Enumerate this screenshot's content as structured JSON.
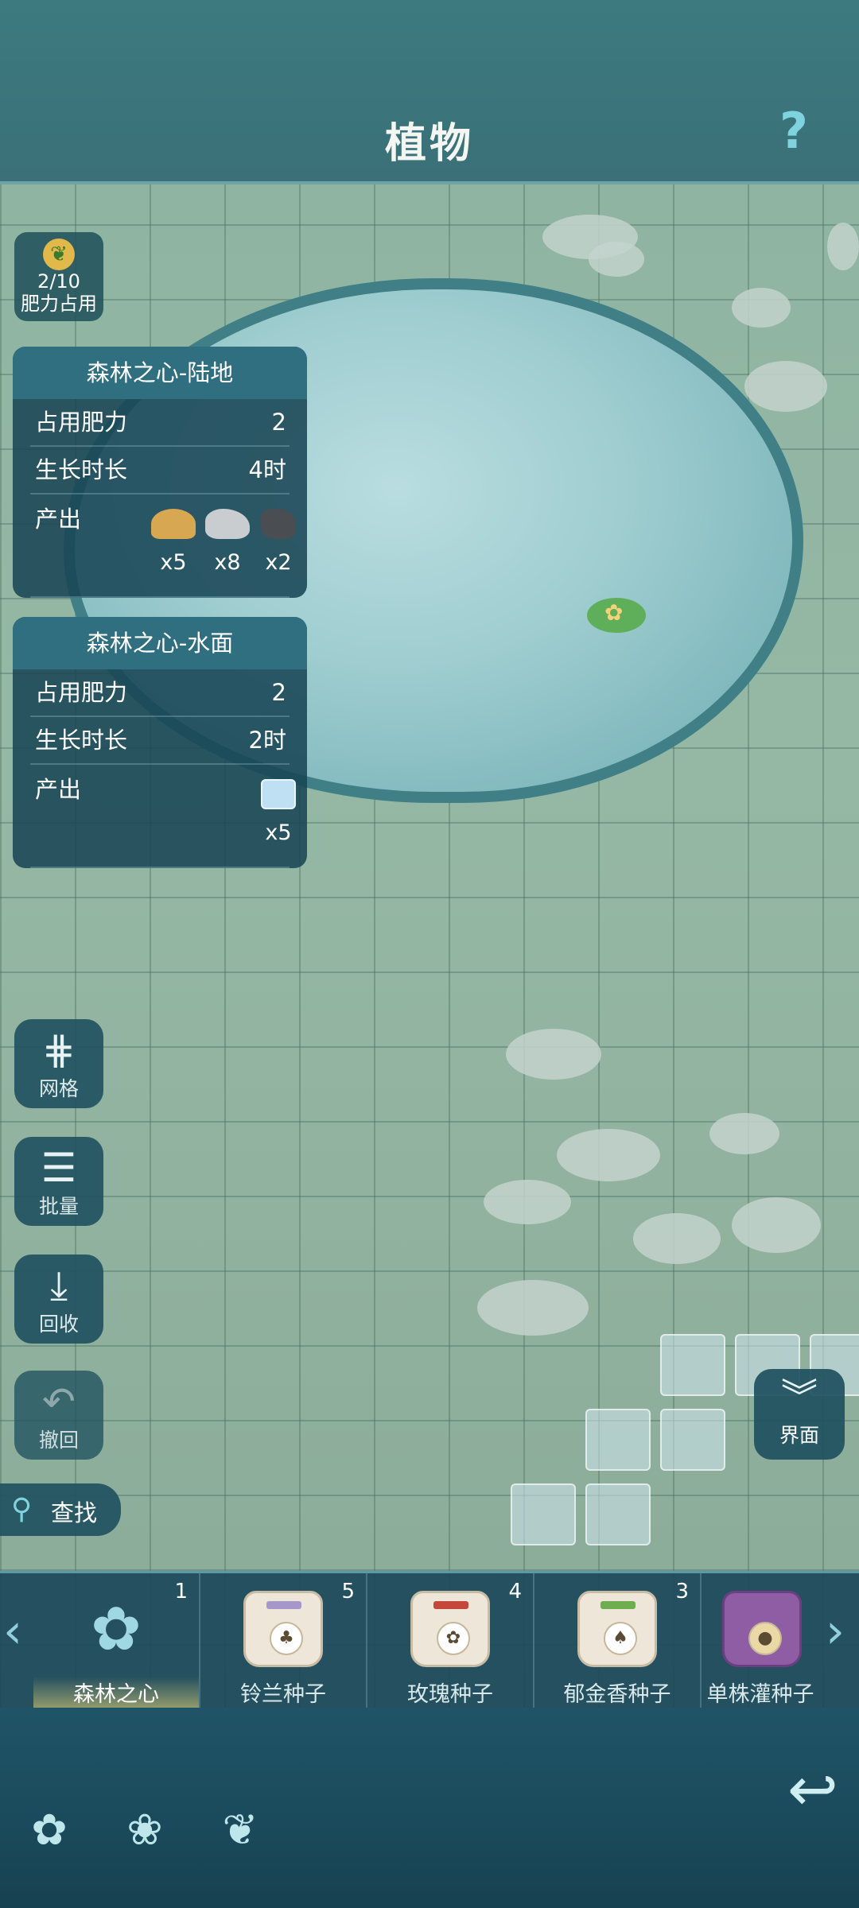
{
  "header": {
    "title": "植物",
    "help_icon": "question-mark-icon"
  },
  "fertilizer": {
    "count": "2/10",
    "label": "肥力占用",
    "icon": "leaf-icon"
  },
  "cards": [
    {
      "title": "森林之心-陆地",
      "rows": [
        {
          "key": "占用肥力",
          "value": "2"
        },
        {
          "key": "生长时长",
          "value": "4时"
        }
      ],
      "output_label": "产出",
      "outputs": [
        {
          "icon": "sand-pile-icon",
          "qty": "x5"
        },
        {
          "icon": "stone-icon",
          "qty": "x8"
        },
        {
          "icon": "coal-icon",
          "qty": "x2"
        }
      ]
    },
    {
      "title": "森林之心-水面",
      "rows": [
        {
          "key": "占用肥力",
          "value": "2"
        },
        {
          "key": "生长时长",
          "value": "2时"
        }
      ],
      "output_label": "产出",
      "outputs": [
        {
          "icon": "ice-cube-icon",
          "qty": "x5"
        }
      ]
    }
  ],
  "tools": {
    "grid": "网格",
    "batch": "批量",
    "recycle": "回收",
    "undo": "撤回",
    "ui": "界面",
    "search": "查找"
  },
  "seeds": [
    {
      "name": "森林之心",
      "count": "1",
      "selected": true
    },
    {
      "name": "铃兰种子",
      "count": "5"
    },
    {
      "name": "玫瑰种子",
      "count": "4"
    },
    {
      "name": "郁金香种子",
      "count": "3"
    },
    {
      "name": "单株灌种子",
      "count": ""
    }
  ],
  "colors": {
    "accent": "#7fd3df",
    "panel": "#1f5466",
    "header": "#3c7a80"
  }
}
